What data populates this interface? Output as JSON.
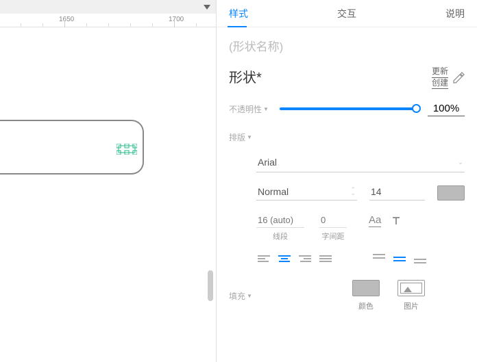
{
  "canvas": {
    "ruler_ticks": [
      "1650",
      "1700"
    ]
  },
  "tabs": {
    "style": "样式",
    "interaction": "交互",
    "notes": "说明"
  },
  "shape_name_placeholder": "(形状名称)",
  "shape_title": "形状*",
  "title_actions": {
    "update": "更新",
    "create": "创建"
  },
  "opacity": {
    "label": "不透明性",
    "value": "100%"
  },
  "typography": {
    "label": "排版",
    "font_family": "Arial",
    "font_weight": "Normal",
    "font_size": "14",
    "line_height_placeholder": "16 (auto)",
    "line_height_label": "线段",
    "letter_spacing_placeholder": "0",
    "letter_spacing_label": "字间距"
  },
  "fill": {
    "label": "填充",
    "color_label": "颜色",
    "image_label": "图片"
  }
}
